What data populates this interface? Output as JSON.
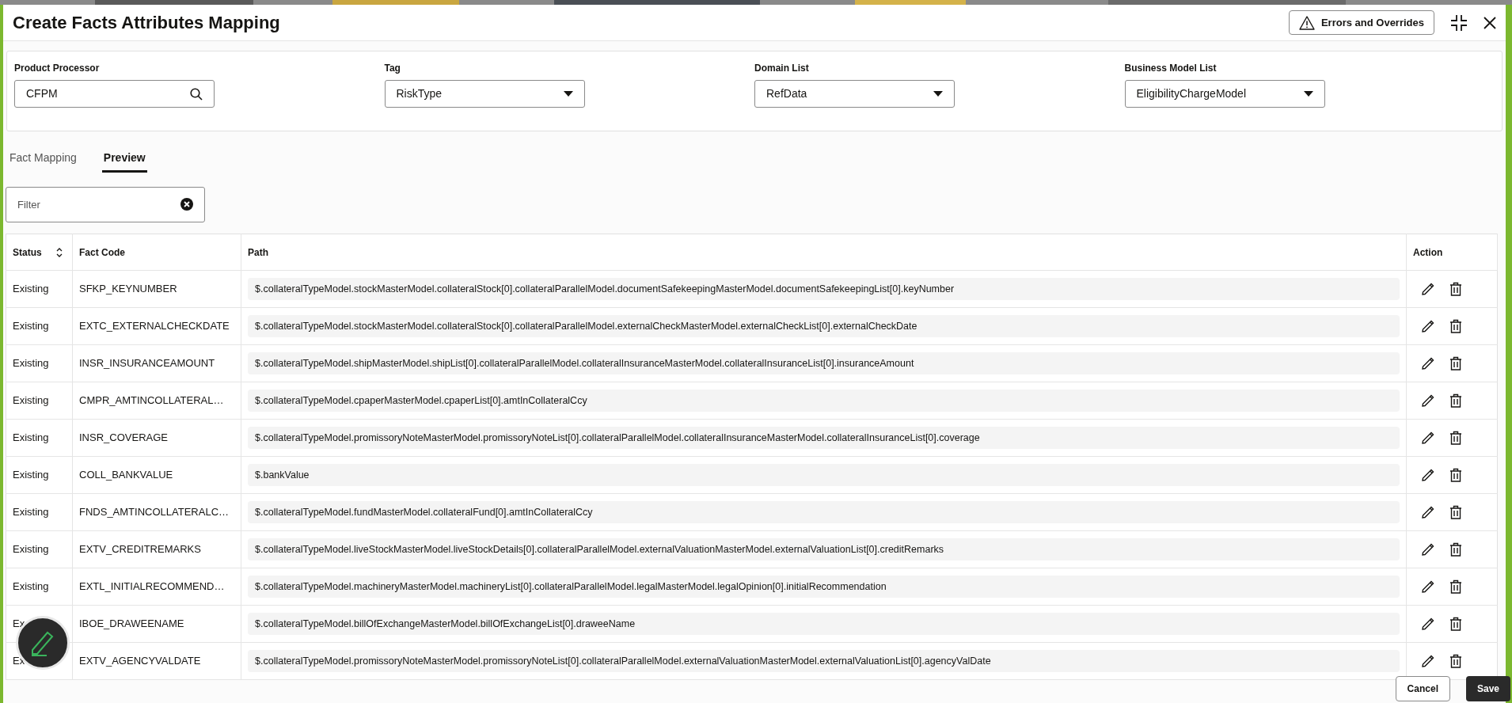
{
  "title": "Create Facts Attributes Mapping",
  "errors_button": {
    "label": "Errors and Overrides"
  },
  "fields": [
    {
      "label": "Product Processor",
      "value": "CFPM",
      "kind": "search"
    },
    {
      "label": "Tag",
      "value": "RiskType",
      "kind": "select"
    },
    {
      "label": "Domain List",
      "value": "RefData",
      "kind": "select"
    },
    {
      "label": "Business Model List",
      "value": "EligibilityChargeModel",
      "kind": "select"
    }
  ],
  "tabs": [
    {
      "label": "Fact Mapping",
      "selected": false
    },
    {
      "label": "Preview",
      "selected": true
    }
  ],
  "filter": {
    "placeholder": "Filter"
  },
  "table": {
    "columns": [
      {
        "label": "Status",
        "sortable": true
      },
      {
        "label": "Fact Code",
        "sortable": false
      },
      {
        "label": "Path",
        "sortable": false
      },
      {
        "label": "Action",
        "sortable": false
      }
    ],
    "rows": [
      {
        "status": "Existing",
        "fact_code": "SFKP_KEYNUMBER",
        "path": "$.collateralTypeModel.stockMasterModel.collateralStock[0].collateralParallelModel.documentSafekeepingMasterModel.documentSafekeepingList[0].keyNumber"
      },
      {
        "status": "Existing",
        "fact_code": "EXTC_EXTERNALCHECKDATE",
        "path": "$.collateralTypeModel.stockMasterModel.collateralStock[0].collateralParallelModel.externalCheckMasterModel.externalCheckList[0].externalCheckDate"
      },
      {
        "status": "Existing",
        "fact_code": "INSR_INSURANCEAMOUNT",
        "path": "$.collateralTypeModel.shipMasterModel.shipList[0].collateralParallelModel.collateralInsuranceMasterModel.collateralInsuranceList[0].insuranceAmount"
      },
      {
        "status": "Existing",
        "fact_code": "CMPR_AMTINCOLLATERAL…",
        "path": "$.collateralTypeModel.cpaperMasterModel.cpaperList[0].amtInCollateralCcy"
      },
      {
        "status": "Existing",
        "fact_code": "INSR_COVERAGE",
        "path": "$.collateralTypeModel.promissoryNoteMasterModel.promissoryNoteList[0].collateralParallelModel.collateralInsuranceMasterModel.collateralInsuranceList[0].coverage"
      },
      {
        "status": "Existing",
        "fact_code": "COLL_BANKVALUE",
        "path": "$.bankValue"
      },
      {
        "status": "Existing",
        "fact_code": "FNDS_AMTINCOLLATERALC…",
        "path": "$.collateralTypeModel.fundMasterModel.collateralFund[0].amtInCollateralCcy"
      },
      {
        "status": "Existing",
        "fact_code": "EXTV_CREDITREMARKS",
        "path": "$.collateralTypeModel.liveStockMasterModel.liveStockDetails[0].collateralParallelModel.externalValuationMasterModel.externalValuationList[0].creditRemarks"
      },
      {
        "status": "Existing",
        "fact_code": "EXTL_INITIALRECOMMEND…",
        "path": "$.collateralTypeModel.machineryMasterModel.machineryList[0].collateralParallelModel.legalMasterModel.legalOpinion[0].initialRecommendation"
      },
      {
        "status": "Ex",
        "fact_code": "IBOE_DRAWEENAME",
        "path": "$.collateralTypeModel.billOfExchangeMasterModel.billOfExchangeList[0].draweeName"
      },
      {
        "status": "Ex",
        "fact_code": "EXTV_AGENCYVALDATE",
        "path": "$.collateralTypeModel.promissoryNoteMasterModel.promissoryNoteList[0].collateralParallelModel.externalValuationMasterModel.externalValuationList[0].agencyValDate"
      }
    ]
  },
  "footer_buttons": [
    {
      "label": "Cancel",
      "kind": "secondary"
    },
    {
      "label": "Save",
      "kind": "primary"
    }
  ]
}
